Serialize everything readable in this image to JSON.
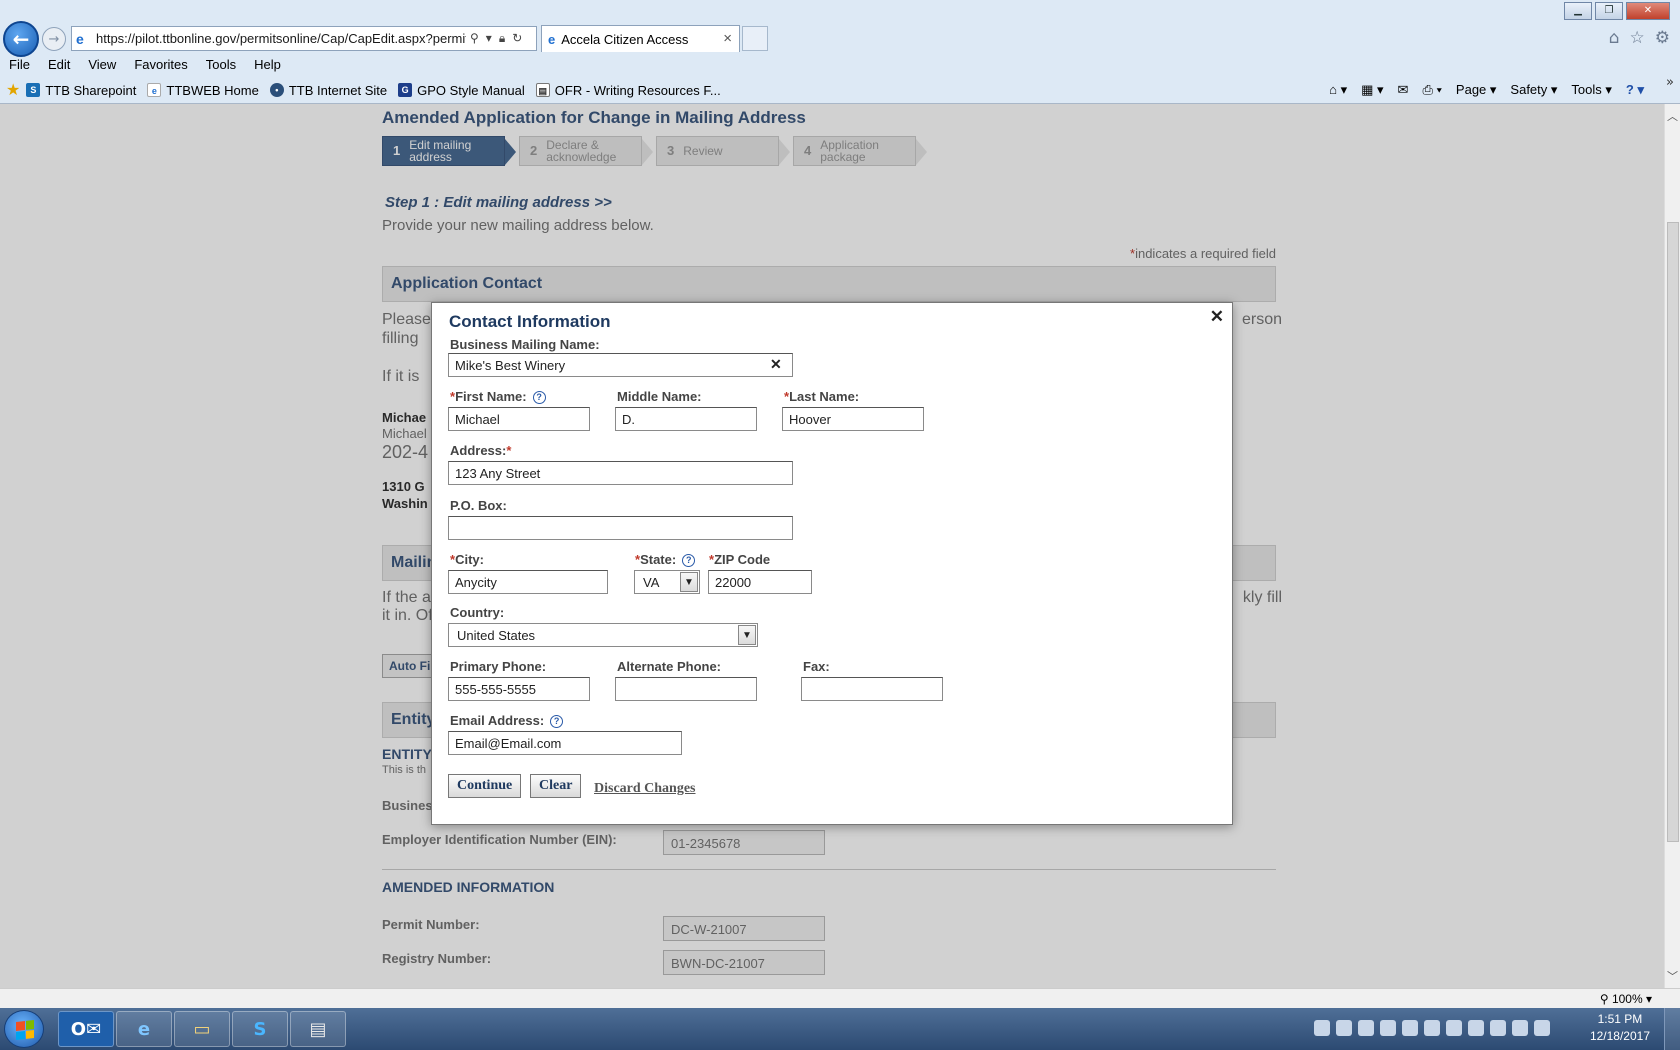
{
  "browser": {
    "url": "https://pilot.ttbonline.gov/permitsonline/Cap/CapEdit.aspx?permitTyp",
    "tab_title": "Accela Citizen Access",
    "menu": [
      "File",
      "Edit",
      "View",
      "Favorites",
      "Tools",
      "Help"
    ],
    "favorites": [
      "TTB Sharepoint",
      "TTBWEB Home",
      "TTB Internet Site",
      "GPO Style Manual",
      "OFR - Writing Resources F..."
    ],
    "commands": [
      "Page ▾",
      "Safety ▾",
      "Tools ▾"
    ],
    "zoom": "100%"
  },
  "page": {
    "title": "Amended Application for Change in Mailing Address",
    "steps": [
      {
        "num": "1",
        "label": "Edit mailing address"
      },
      {
        "num": "2",
        "label": "Declare & acknowledge"
      },
      {
        "num": "3",
        "label": "Review"
      },
      {
        "num": "4",
        "label": "Application package"
      }
    ],
    "step_heading": "Step 1 : Edit mailing address >>",
    "step_description": "Provide your new mailing address below.",
    "required_note": "indicates a required field",
    "section_application_contact": "Application Contact",
    "bg_please_left": "Please",
    "bg_please_right": "erson",
    "bg_filling": "filling",
    "bg_if_it_is": "If it is",
    "bg_name_bold": "Michae",
    "bg_name_light": "Michael",
    "bg_phone": "202-4",
    "bg_addr1": "1310 G",
    "bg_addr2": "Washin",
    "section_mailing": "Mailin",
    "bg_ifthe": "If the a",
    "bg_ifthe_right": "kly fill",
    "bg_itin": "it in. Of",
    "autofill": "Auto Fi",
    "section_entity": "Entity",
    "entity_heading": "ENTITY",
    "entity_sub": "This is th",
    "business_label": "Busines",
    "ein_label": "Employer Identification Number (EIN):",
    "ein_value": "01-2345678",
    "amended_heading": "AMENDED INFORMATION",
    "permit_label": "Permit Number:",
    "permit_value": "DC-W-21007",
    "registry_label": "Registry Number:",
    "registry_value": "BWN-DC-21007"
  },
  "modal": {
    "title": "Contact Information",
    "business_name_label": "Business Mailing Name:",
    "business_name_value": "Mike's Best Winery",
    "first_name_label": "First Name:",
    "first_name_value": "Michael",
    "middle_name_label": "Middle Name:",
    "middle_name_value": "D.",
    "last_name_label": "Last Name:",
    "last_name_value": "Hoover",
    "address_label": "Address:",
    "address_value": "123 Any Street",
    "pobox_label": "P.O. Box:",
    "pobox_value": "",
    "city_label": "City:",
    "city_value": "Anycity",
    "state_label": "State:",
    "state_value": "VA",
    "zip_label": "ZIP Code",
    "zip_value": "22000",
    "country_label": "Country:",
    "country_value": "United States",
    "primary_phone_label": "Primary Phone:",
    "primary_phone_value": "555-555-5555",
    "alt_phone_label": "Alternate Phone:",
    "alt_phone_value": "",
    "fax_label": "Fax:",
    "fax_value": "",
    "email_label": "Email Address:",
    "email_value": "Email@Email.com",
    "continue_label": "Continue",
    "clear_label": "Clear",
    "discard_label": "Discard Changes"
  },
  "taskbar": {
    "time": "1:51 PM",
    "date": "12/18/2017"
  },
  "colors": {
    "accent": "#3d5a80",
    "required": "#c0392b",
    "step_active": "#4a6c94"
  }
}
